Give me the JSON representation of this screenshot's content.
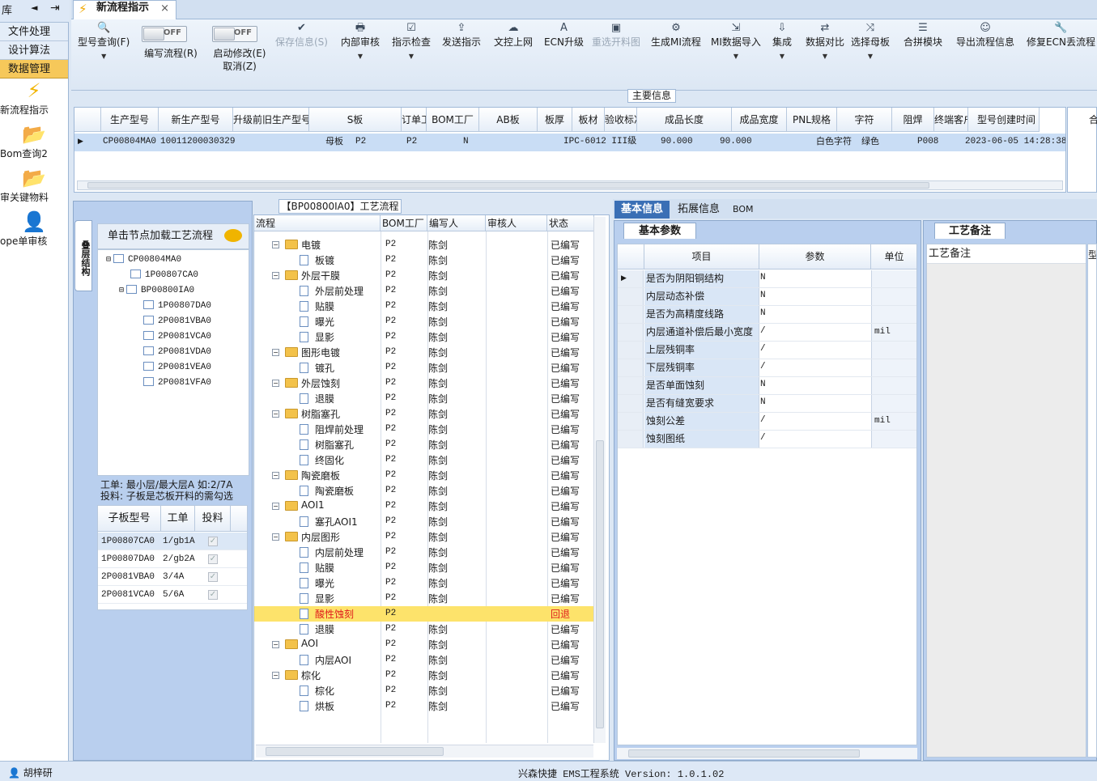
{
  "left_top": {
    "text": "库",
    "left_arrow": "◄",
    "pin": "⇥"
  },
  "nav": {
    "buttons": [
      {
        "label": "文件处理"
      },
      {
        "label": "设计算法"
      },
      {
        "label": "数据管理"
      }
    ],
    "items": [
      {
        "label": "新流程指示",
        "icon": "lightning-icon"
      },
      {
        "label": "Bom查询2",
        "icon": "folder-icon"
      },
      {
        "label": "审关键物料",
        "icon": "folder-icon"
      },
      {
        "label": "ope单审核",
        "icon": "user-icon"
      }
    ]
  },
  "tab": {
    "title": "新流程指示",
    "close": "×"
  },
  "toolbar": {
    "items": [
      {
        "label": "型号查询(F)",
        "icon": "search-icon",
        "glyph": "🔍",
        "dropdown": true
      },
      {
        "label": "编写流程(R)",
        "toggle": "OFF"
      },
      {
        "label": "启动修改(E)",
        "label2": "取消(Z)",
        "toggle": "OFF"
      },
      {
        "label": "保存信息(S)",
        "icon": "check-icon",
        "glyph": "✔",
        "disabled": true
      },
      {
        "label": "内部审核",
        "icon": "print-icon",
        "glyph": "🖶",
        "dropdown": true
      },
      {
        "label": "指示检查",
        "icon": "checkbox-icon",
        "glyph": "☑",
        "dropdown": true
      },
      {
        "label": "发送指示",
        "icon": "upload-icon",
        "glyph": "⇪"
      },
      {
        "label": "文控上网",
        "icon": "cloud-icon",
        "glyph": "☁"
      },
      {
        "label": "ECN升级",
        "icon": "ecn-icon",
        "glyph": "A"
      },
      {
        "label": "重选开料图",
        "icon": "image-icon",
        "glyph": "▣",
        "disabled": true
      },
      {
        "label": "生成MI流程",
        "icon": "gears-icon",
        "glyph": "⚙"
      },
      {
        "label": "MI数据导入",
        "icon": "import-icon",
        "glyph": "⇲",
        "dropdown": true
      },
      {
        "label": "集成",
        "icon": "download-icon",
        "glyph": "⇩",
        "dropdown": true
      },
      {
        "label": "数据对比",
        "icon": "compare-icon",
        "glyph": "⇄",
        "dropdown": true
      },
      {
        "label": "选择母板",
        "icon": "shuffle-icon",
        "glyph": "⤨",
        "dropdown": true
      },
      {
        "label": "合拼模块",
        "icon": "list-icon",
        "glyph": "☰"
      },
      {
        "label": "导出流程信息",
        "icon": "smile-icon",
        "glyph": "☺"
      },
      {
        "label": "修复ECN丢流程",
        "icon": "wrench-icon",
        "glyph": "🔧"
      }
    ]
  },
  "main_info": {
    "title": "主要信息",
    "columns": [
      "生产型号",
      "新生产型号",
      "升级前旧生产型号",
      "S板",
      "订单工厂",
      "BOM工厂",
      "AB板",
      "板厚",
      "板材",
      "验收标准",
      "成品长度",
      "成品宽度",
      "PNL规格",
      "字符",
      "阻焊",
      "终端客户代码",
      "型号创建时间"
    ],
    "row": [
      "CP00804MA0",
      "10011200030329",
      "",
      "母板",
      "P2",
      "P2",
      "N",
      "",
      "",
      "IPC-6012 III级",
      "90.000",
      "90.000",
      "",
      "白色字符",
      "绿色",
      "P008",
      "2023-06-05 14:28:38"
    ],
    "right_stub": "合"
  },
  "left_panel": {
    "vertical_tab": "叠层结构",
    "tree_header": "单击节点加载工艺流程",
    "tree": [
      {
        "label": "CP00804MA0",
        "level": 0,
        "expander": "⊟"
      },
      {
        "label": "1P00807CA0",
        "level": 1
      },
      {
        "label": "BP00800IA0",
        "level": 1,
        "expander": "⊟"
      },
      {
        "label": "1P00807DA0",
        "level": 2
      },
      {
        "label": "2P0081VBA0",
        "level": 2
      },
      {
        "label": "2P0081VCA0",
        "level": 2
      },
      {
        "label": "2P0081VDA0",
        "level": 2
      },
      {
        "label": "2P0081VEA0",
        "level": 2
      },
      {
        "label": "2P0081VFA0",
        "level": 2
      }
    ],
    "note_line1": "工单: 最小层/最大层A 如:2/7A",
    "note_line2": "投料: 子板是芯板开料的需勾选",
    "sub_columns": [
      "子板型号",
      "工单",
      "投料"
    ],
    "sub_rows": [
      {
        "model": "1P00807CA0",
        "order": "1/gb1A",
        "checked": true
      },
      {
        "model": "1P00807DA0",
        "order": "2/gb2A",
        "checked": true
      },
      {
        "model": "2P0081VBA0",
        "order": "3/4A",
        "checked": true
      },
      {
        "model": "2P0081VCA0",
        "order": "5/6A",
        "checked": true
      }
    ]
  },
  "flow": {
    "title": "【BP00800IA0】工艺流程",
    "columns": [
      "流程",
      "BOM工厂",
      "编写人",
      "审核人",
      "状态"
    ],
    "rows": [
      {
        "name": "电镀",
        "type": "folder",
        "level": 0,
        "bom": "P2",
        "author": "陈剑",
        "status": "已编写"
      },
      {
        "name": "板镀",
        "type": "page",
        "level": 1,
        "bom": "P2",
        "author": "陈剑",
        "status": "已编写"
      },
      {
        "name": "外层干膜",
        "type": "folder",
        "level": 0,
        "bom": "P2",
        "author": "陈剑",
        "status": "已编写"
      },
      {
        "name": "外层前处理",
        "type": "page",
        "level": 1,
        "bom": "P2",
        "author": "陈剑",
        "status": "已编写"
      },
      {
        "name": "贴膜",
        "type": "page",
        "level": 1,
        "bom": "P2",
        "author": "陈剑",
        "status": "已编写"
      },
      {
        "name": "曝光",
        "type": "page",
        "level": 1,
        "bom": "P2",
        "author": "陈剑",
        "status": "已编写"
      },
      {
        "name": "显影",
        "type": "page",
        "level": 1,
        "bom": "P2",
        "author": "陈剑",
        "status": "已编写"
      },
      {
        "name": "图形电镀",
        "type": "folder",
        "level": 0,
        "bom": "P2",
        "author": "陈剑",
        "status": "已编写"
      },
      {
        "name": "镀孔",
        "type": "page",
        "level": 1,
        "bom": "P2",
        "author": "陈剑",
        "status": "已编写"
      },
      {
        "name": "外层蚀刻",
        "type": "folder",
        "level": 0,
        "bom": "P2",
        "author": "陈剑",
        "status": "已编写"
      },
      {
        "name": "退膜",
        "type": "page",
        "level": 1,
        "bom": "P2",
        "author": "陈剑",
        "status": "已编写"
      },
      {
        "name": "树脂塞孔",
        "type": "folder",
        "level": 0,
        "bom": "P2",
        "author": "陈剑",
        "status": "已编写"
      },
      {
        "name": "阻焊前处理",
        "type": "page",
        "level": 1,
        "bom": "P2",
        "author": "陈剑",
        "status": "已编写"
      },
      {
        "name": "树脂塞孔",
        "type": "page",
        "level": 1,
        "bom": "P2",
        "author": "陈剑",
        "status": "已编写"
      },
      {
        "name": "终固化",
        "type": "page",
        "level": 1,
        "bom": "P2",
        "author": "陈剑",
        "status": "已编写"
      },
      {
        "name": "陶瓷磨板",
        "type": "folder",
        "level": 0,
        "bom": "P2",
        "author": "陈剑",
        "status": "已编写"
      },
      {
        "name": "陶瓷磨板",
        "type": "page",
        "level": 1,
        "bom": "P2",
        "author": "陈剑",
        "status": "已编写"
      },
      {
        "name": "AOI1",
        "type": "folder",
        "level": 0,
        "bom": "P2",
        "author": "陈剑",
        "status": "已编写"
      },
      {
        "name": "塞孔AOI1",
        "type": "page",
        "level": 1,
        "bom": "P2",
        "author": "陈剑",
        "status": "已编写"
      },
      {
        "name": "内层图形",
        "type": "folder",
        "level": 0,
        "bom": "P2",
        "author": "陈剑",
        "status": "已编写"
      },
      {
        "name": "内层前处理",
        "type": "page",
        "level": 1,
        "bom": "P2",
        "author": "陈剑",
        "status": "已编写"
      },
      {
        "name": "贴膜",
        "type": "page",
        "level": 1,
        "bom": "P2",
        "author": "陈剑",
        "status": "已编写"
      },
      {
        "name": "曝光",
        "type": "page",
        "level": 1,
        "bom": "P2",
        "author": "陈剑",
        "status": "已编写"
      },
      {
        "name": "显影",
        "type": "page",
        "level": 1,
        "bom": "P2",
        "author": "陈剑",
        "status": "已编写"
      },
      {
        "name": "酸性蚀刻",
        "type": "page",
        "level": 1,
        "bom": "P2",
        "author": "",
        "status": "回退",
        "selected": true
      },
      {
        "name": "退膜",
        "type": "page",
        "level": 1,
        "bom": "P2",
        "author": "陈剑",
        "status": "已编写"
      },
      {
        "name": "AOI",
        "type": "folder",
        "level": 0,
        "bom": "P2",
        "author": "陈剑",
        "status": "已编写"
      },
      {
        "name": "内层AOI",
        "type": "page",
        "level": 1,
        "bom": "P2",
        "author": "陈剑",
        "status": "已编写"
      },
      {
        "name": "棕化",
        "type": "folder",
        "level": 0,
        "bom": "P2",
        "author": "陈剑",
        "status": "已编写"
      },
      {
        "name": "棕化",
        "type": "page",
        "level": 1,
        "bom": "P2",
        "author": "陈剑",
        "status": "已编写"
      },
      {
        "name": "烘板",
        "type": "page",
        "level": 1,
        "bom": "P2",
        "author": "陈剑",
        "status": "已编写"
      }
    ]
  },
  "right_tabs": [
    "基本信息",
    "拓展信息",
    "BOM"
  ],
  "basic": {
    "title": "基本参数",
    "columns": [
      "项目",
      "参数",
      "单位"
    ],
    "rows": [
      {
        "item": "是否为阴阳铜结构",
        "value": "N",
        "unit": ""
      },
      {
        "item": "内层动态补偿",
        "value": "N",
        "unit": ""
      },
      {
        "item": "是否为高精度线路",
        "value": "N",
        "unit": ""
      },
      {
        "item": "内层通道补偿后最小宽度",
        "value": "/",
        "unit": "mil"
      },
      {
        "item": "上层残铜率",
        "value": "/",
        "unit": ""
      },
      {
        "item": "下层残铜率",
        "value": "/",
        "unit": ""
      },
      {
        "item": "是否单面蚀刻",
        "value": "N",
        "unit": ""
      },
      {
        "item": "是否有缝宽要求",
        "value": "N",
        "unit": ""
      },
      {
        "item": "蚀刻公差",
        "value": "/",
        "unit": "mil"
      },
      {
        "item": "蚀刻图纸",
        "value": "/",
        "unit": ""
      }
    ]
  },
  "notes": {
    "title": "工艺备注",
    "header": "工艺备注",
    "stub": "型"
  },
  "status": {
    "user": "胡梓研",
    "version": "兴森快捷 EMS工程系统 Version: 1.0.1.02"
  }
}
